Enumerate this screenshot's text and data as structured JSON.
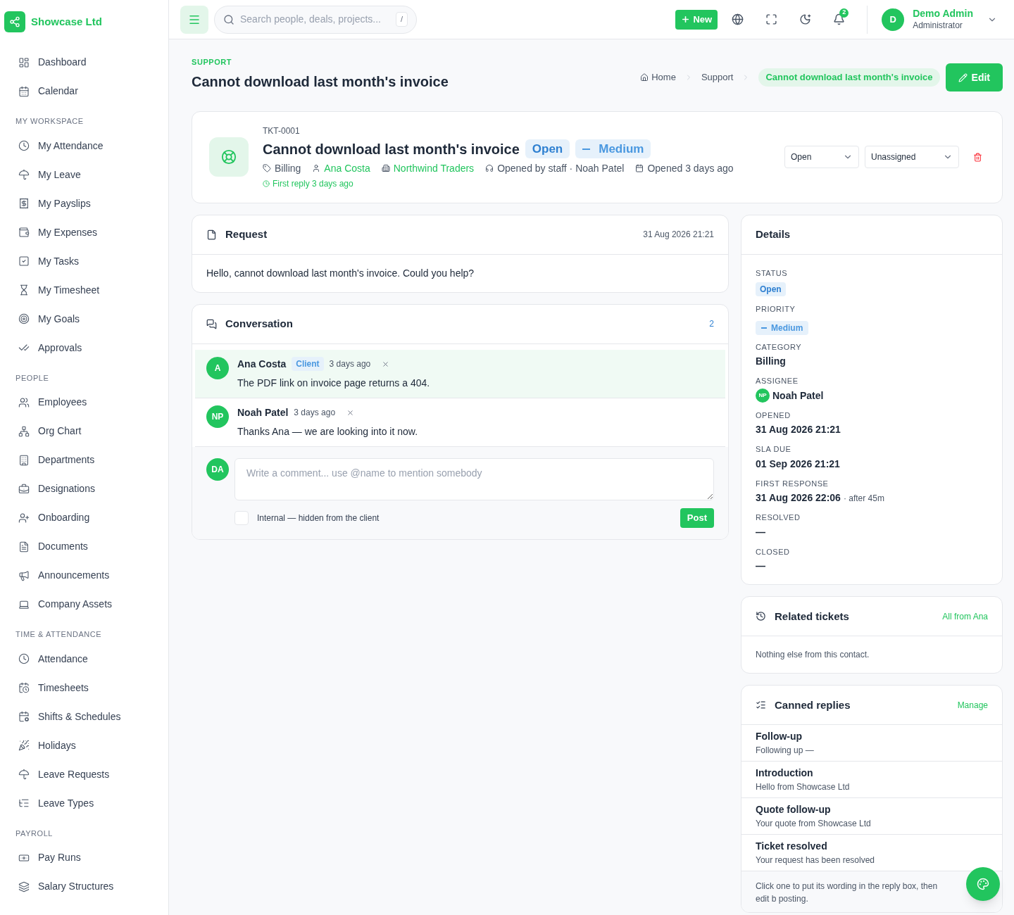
{
  "sidebar": {
    "brand": "Showcase Ltd",
    "sections": [
      {
        "items": [
          {
            "label": "Dashboard"
          },
          {
            "label": "Calendar"
          }
        ]
      },
      {
        "heading": "MY WORKSPACE",
        "items": [
          {
            "label": "My Attendance"
          },
          {
            "label": "My Leave"
          },
          {
            "label": "My Payslips"
          },
          {
            "label": "My Expenses"
          },
          {
            "label": "My Tasks"
          },
          {
            "label": "My Timesheet"
          },
          {
            "label": "My Goals"
          },
          {
            "label": "Approvals"
          }
        ]
      },
      {
        "heading": "PEOPLE",
        "items": [
          {
            "label": "Employees"
          },
          {
            "label": "Org Chart"
          },
          {
            "label": "Departments"
          },
          {
            "label": "Designations"
          },
          {
            "label": "Onboarding"
          },
          {
            "label": "Documents"
          },
          {
            "label": "Announcements"
          },
          {
            "label": "Company Assets"
          }
        ]
      },
      {
        "heading": "TIME & ATTENDANCE",
        "items": [
          {
            "label": "Attendance"
          },
          {
            "label": "Timesheets"
          },
          {
            "label": "Shifts & Schedules"
          },
          {
            "label": "Holidays"
          },
          {
            "label": "Leave Requests"
          },
          {
            "label": "Leave Types"
          }
        ]
      },
      {
        "heading": "PAYROLL",
        "items": [
          {
            "label": "Pay Runs"
          },
          {
            "label": "Salary Structures"
          }
        ]
      }
    ]
  },
  "topbar": {
    "search": {
      "placeholder": "Search people, deals, projects...",
      "shortcut": "/"
    },
    "new_button": "New",
    "notification_count": "2",
    "user": {
      "initial": "D",
      "name": "Demo Admin",
      "role": "Administrator"
    }
  },
  "header": {
    "eyebrow": "SUPPORT",
    "title": "Cannot download last month's invoice",
    "breadcrumb": [
      "Home",
      "Support",
      "Cannot download last month's invoice"
    ],
    "edit_button": "Edit"
  },
  "ticket": {
    "id": "TKT-0001",
    "title": "Cannot download last month's invoice",
    "status_badge": "Open",
    "priority_badge": "Medium",
    "meta": [
      {
        "kind": "plain",
        "text": "Billing"
      },
      {
        "kind": "link",
        "text": "Ana Costa"
      },
      {
        "kind": "link",
        "text": "Northwind Traders"
      },
      {
        "kind": "plain",
        "text": "Opened by staff · Noah Patel"
      },
      {
        "kind": "plain",
        "text": "Opened 3 days ago"
      }
    ],
    "first_reply": "First reply 3 days ago",
    "status_select": "Open",
    "assignee_select": "Unassigned"
  },
  "request": {
    "title": "Request",
    "time": "31 Aug 2026 21:21",
    "body": "Hello, cannot download last month's invoice. Could you help?"
  },
  "conversation": {
    "title": "Conversation",
    "count": "2",
    "messages": [
      {
        "initials": "A",
        "author": "Ana Costa",
        "tag": "Client",
        "time": "3 days ago",
        "body": "The PDF link on invoice page returns a 404.",
        "highlighted": true
      },
      {
        "initials": "NP",
        "author": "Noah Patel",
        "time": "3 days ago",
        "body": "Thanks Ana — we are looking into it now.",
        "highlighted": false
      }
    ],
    "composer": {
      "initials": "DA",
      "placeholder": "Write a comment... use @name to mention somebody",
      "internal_label": "Internal — hidden from the client",
      "internal_checked": false,
      "post_button": "Post"
    }
  },
  "details": {
    "title": "Details",
    "fields": [
      {
        "label": "STATUS",
        "kind": "status",
        "value": "Open"
      },
      {
        "label": "PRIORITY",
        "kind": "priority",
        "value": "Medium"
      },
      {
        "label": "CATEGORY",
        "kind": "text",
        "value": "Billing"
      },
      {
        "label": "ASSIGNEE",
        "kind": "person",
        "initials": "NP",
        "value": "Noah Patel"
      },
      {
        "label": "OPENED",
        "kind": "text",
        "value": "31 Aug 2026 21:21"
      },
      {
        "label": "SLA DUE",
        "kind": "text",
        "value": "01 Sep 2026 21:21"
      },
      {
        "label": "FIRST RESPONSE",
        "kind": "text",
        "value": "31 Aug 2026 22:06",
        "note": "· after 45m"
      },
      {
        "label": "RESOLVED",
        "kind": "text",
        "value": "—"
      },
      {
        "label": "CLOSED",
        "kind": "text",
        "value": "—"
      }
    ]
  },
  "related": {
    "title": "Related tickets",
    "link": "All from Ana",
    "empty": "Nothing else from this contact."
  },
  "canned": {
    "title": "Canned replies",
    "link": "Manage",
    "items": [
      {
        "title": "Follow-up",
        "preview": "Following up —"
      },
      {
        "title": "Introduction",
        "preview": "Hello from Showcase Ltd"
      },
      {
        "title": "Quote follow-up",
        "preview": "Your quote from Showcase Ltd"
      },
      {
        "title": "Ticket resolved",
        "preview": "Your request has been resolved"
      }
    ],
    "hint": "Click one to put its wording in the reply box, then edit b posting."
  }
}
